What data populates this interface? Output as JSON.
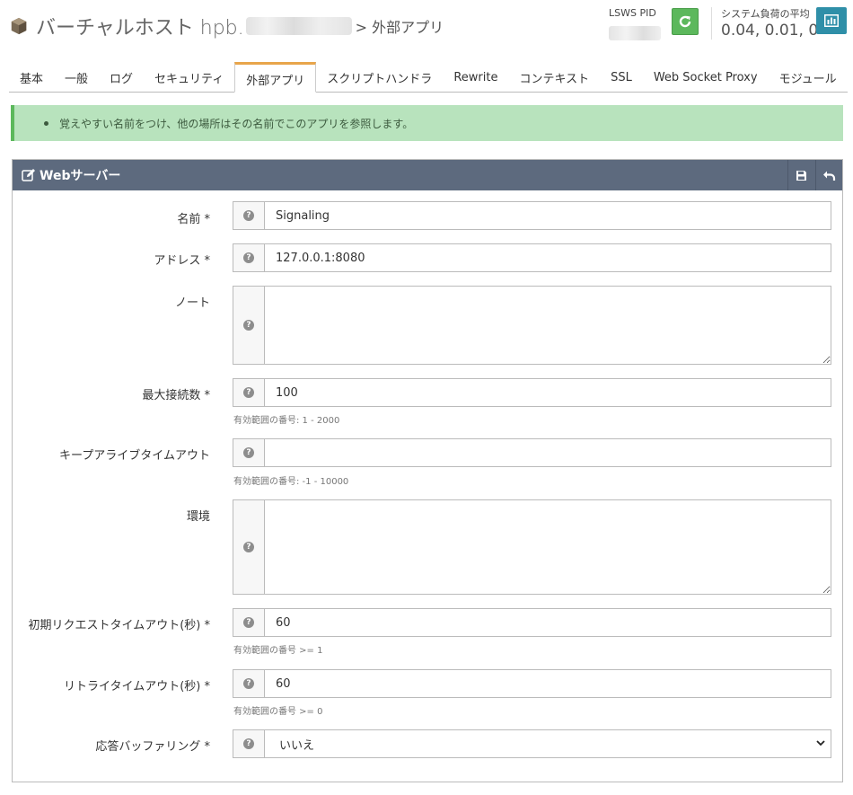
{
  "header": {
    "title_prefix": "バーチャルホスト hpb.",
    "breadcrumb": "> 外部アプリ",
    "pid_label": "LSWS PID",
    "load_label": "システム負荷の平均",
    "load_value": "0.04, 0.01, 0"
  },
  "tabs": [
    "基本",
    "一般",
    "ログ",
    "セキュリティ",
    "外部アプリ",
    "スクリプトハンドラ",
    "Rewrite",
    "コンテキスト",
    "SSL",
    "Web Socket Proxy",
    "モジュール"
  ],
  "active_tab": "外部アプリ",
  "alert": {
    "message": "覚えやすい名前をつけ、他の場所はその名前でこのアプリを参照します。"
  },
  "panel": {
    "title": "Webサーバー",
    "fields": {
      "name": {
        "label": "名前 *",
        "value": "Signaling"
      },
      "address": {
        "label": "アドレス *",
        "value": "127.0.0.1:8080"
      },
      "note": {
        "label": "ノート",
        "value": ""
      },
      "max_conns": {
        "label": "最大接続数 *",
        "value": "100",
        "hint": "有効範囲の番号: 1 - 2000"
      },
      "keepalive": {
        "label": "キープアライブタイムアウト",
        "value": "",
        "hint": "有効範囲の番号: -1 - 10000"
      },
      "env": {
        "label": "環境",
        "value": ""
      },
      "init_timeout": {
        "label": "初期リクエストタイムアウト(秒) *",
        "value": "60",
        "hint": "有効範囲の番号 >= 1"
      },
      "retry_timeout": {
        "label": "リトライタイムアウト(秒) *",
        "value": "60",
        "hint": "有効範囲の番号 >= 0"
      },
      "resp_buffer": {
        "label": "応答バッファリング *",
        "value": "いいえ"
      }
    }
  },
  "colors": {
    "accent_tab": "#e8a54b",
    "panel_header": "#5d6a7e",
    "alert_bg": "#b8e3bd",
    "restart_btn": "#5cb85c",
    "chart_btn": "#2f8fa8"
  },
  "icons": [
    "cube-icon",
    "refresh-icon",
    "bar-chart-icon",
    "edit-icon",
    "save-icon",
    "undo-icon",
    "help-icon",
    "chevron-down-icon"
  ]
}
